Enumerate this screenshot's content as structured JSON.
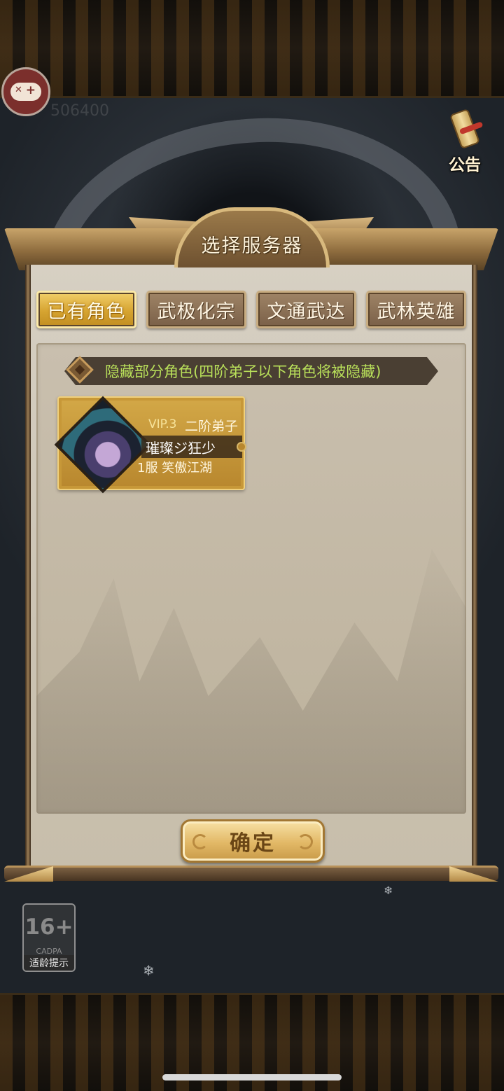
{
  "header": {
    "faint_id": "506400"
  },
  "notice": {
    "label": "公告",
    "icon": "scroll-icon"
  },
  "panel": {
    "title": "选择服务器",
    "tabs": [
      {
        "label": "已有角色",
        "active": true
      },
      {
        "label": "武极化宗",
        "active": false
      },
      {
        "label": "文通武达",
        "active": false
      },
      {
        "label": "武林英雄",
        "active": false
      }
    ],
    "hide_option": {
      "label": "隐藏部分角色(四阶弟子以下角色将被隐藏)"
    },
    "roles": [
      {
        "vip": "VIP.3",
        "rank": "二阶弟子",
        "name": "璀璨ジ狂少",
        "server": "1服 笑傲江湖"
      }
    ],
    "confirm_label": "确定"
  },
  "age_rating": {
    "rating": "16+",
    "org": "CADPA",
    "tip": "适龄提示"
  },
  "colors": {
    "tab_active": "#d6a431",
    "tab_inactive": "#8a6f54",
    "hide_text": "#b9e05a",
    "panel_paper": "#cbc3b3",
    "gamepad": "#7b2f2c"
  }
}
